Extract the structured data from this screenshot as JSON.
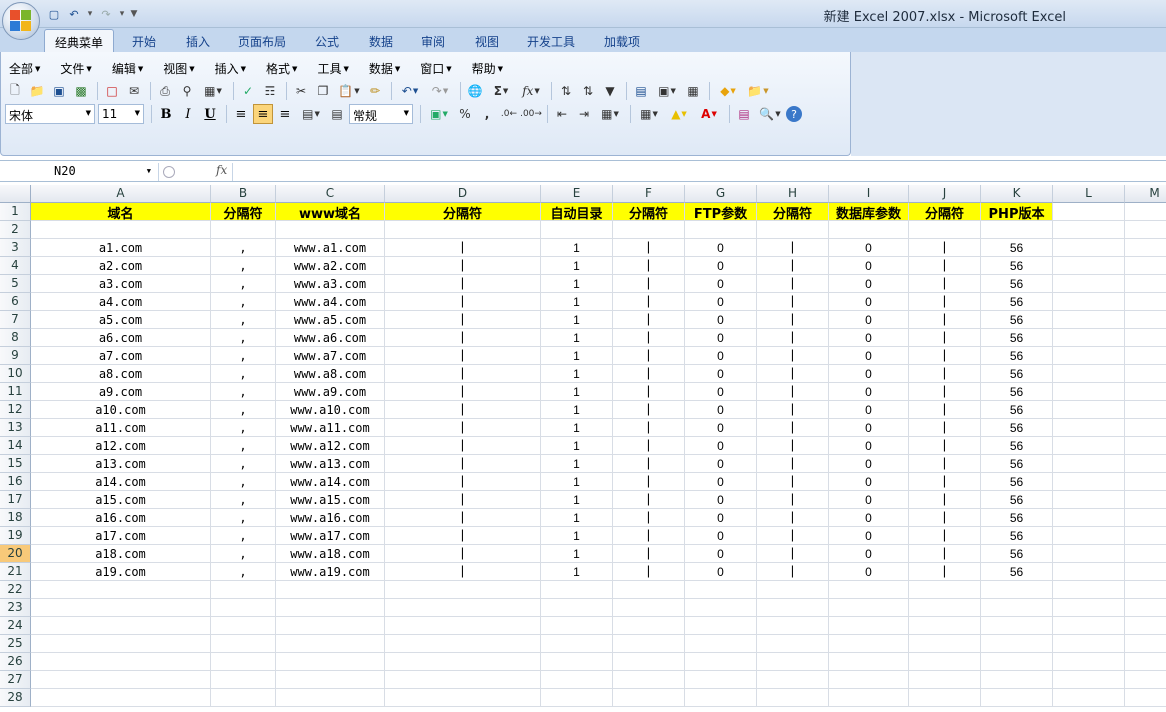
{
  "window": {
    "title": "新建 Excel 2007.xlsx - Microsoft Excel"
  },
  "ribbon_tabs": [
    "经典菜单",
    "开始",
    "插入",
    "页面布局",
    "公式",
    "数据",
    "审阅",
    "视图",
    "开发工具",
    "加载项"
  ],
  "active_tab": "经典菜单",
  "classic_menus": [
    "全部",
    "文件",
    "编辑",
    "视图",
    "插入",
    "格式",
    "工具",
    "数据",
    "窗口",
    "帮助"
  ],
  "toolbar": {
    "font_name": "宋体",
    "font_size": "11",
    "number_format": "常规",
    "bold_label": "B",
    "italic_label": "I",
    "underline_label": "U",
    "sigma_label": "Σ",
    "fx_label": "fx",
    "percent_label": "%",
    "comma_label": ","
  },
  "formula_bar": {
    "name_box": "N20",
    "fx_label": "fx",
    "formula": ""
  },
  "grid": {
    "columns": [
      "A",
      "B",
      "C",
      "D",
      "E",
      "F",
      "G",
      "H",
      "I",
      "J",
      "K",
      "L",
      "M"
    ],
    "row_numbers": [
      "1",
      "2",
      "3",
      "4",
      "5",
      "6",
      "7",
      "8",
      "9",
      "10",
      "11",
      "12",
      "13",
      "14",
      "15",
      "16",
      "17",
      "18",
      "19",
      "20",
      "21",
      "22",
      "23",
      "24",
      "25",
      "26",
      "27",
      "28"
    ],
    "active_row": "20",
    "header_row": [
      "域名",
      "分隔符",
      "www域名",
      "分隔符",
      "自动目录",
      "分隔符",
      "FTP参数",
      "分隔符",
      "数据库参数",
      "分隔符",
      "PHP版本"
    ],
    "data_rows": [
      [
        "a1.com",
        ",",
        "www.a1.com",
        "|",
        "1",
        "|",
        "0",
        "|",
        "0",
        "|",
        "56"
      ],
      [
        "a2.com",
        ",",
        "www.a2.com",
        "|",
        "1",
        "|",
        "0",
        "|",
        "0",
        "|",
        "56"
      ],
      [
        "a3.com",
        ",",
        "www.a3.com",
        "|",
        "1",
        "|",
        "0",
        "|",
        "0",
        "|",
        "56"
      ],
      [
        "a4.com",
        ",",
        "www.a4.com",
        "|",
        "1",
        "|",
        "0",
        "|",
        "0",
        "|",
        "56"
      ],
      [
        "a5.com",
        ",",
        "www.a5.com",
        "|",
        "1",
        "|",
        "0",
        "|",
        "0",
        "|",
        "56"
      ],
      [
        "a6.com",
        ",",
        "www.a6.com",
        "|",
        "1",
        "|",
        "0",
        "|",
        "0",
        "|",
        "56"
      ],
      [
        "a7.com",
        ",",
        "www.a7.com",
        "|",
        "1",
        "|",
        "0",
        "|",
        "0",
        "|",
        "56"
      ],
      [
        "a8.com",
        ",",
        "www.a8.com",
        "|",
        "1",
        "|",
        "0",
        "|",
        "0",
        "|",
        "56"
      ],
      [
        "a9.com",
        ",",
        "www.a9.com",
        "|",
        "1",
        "|",
        "0",
        "|",
        "0",
        "|",
        "56"
      ],
      [
        "a10.com",
        ",",
        "www.a10.com",
        "|",
        "1",
        "|",
        "0",
        "|",
        "0",
        "|",
        "56"
      ],
      [
        "a11.com",
        ",",
        "www.a11.com",
        "|",
        "1",
        "|",
        "0",
        "|",
        "0",
        "|",
        "56"
      ],
      [
        "a12.com",
        ",",
        "www.a12.com",
        "|",
        "1",
        "|",
        "0",
        "|",
        "0",
        "|",
        "56"
      ],
      [
        "a13.com",
        ",",
        "www.a13.com",
        "|",
        "1",
        "|",
        "0",
        "|",
        "0",
        "|",
        "56"
      ],
      [
        "a14.com",
        ",",
        "www.a14.com",
        "|",
        "1",
        "|",
        "0",
        "|",
        "0",
        "|",
        "56"
      ],
      [
        "a15.com",
        ",",
        "www.a15.com",
        "|",
        "1",
        "|",
        "0",
        "|",
        "0",
        "|",
        "56"
      ],
      [
        "a16.com",
        ",",
        "www.a16.com",
        "|",
        "1",
        "|",
        "0",
        "|",
        "0",
        "|",
        "56"
      ],
      [
        "a17.com",
        ",",
        "www.a17.com",
        "|",
        "1",
        "|",
        "0",
        "|",
        "0",
        "|",
        "56"
      ],
      [
        "a18.com",
        ",",
        "www.a18.com",
        "|",
        "1",
        "|",
        "0",
        "|",
        "0",
        "|",
        "56"
      ],
      [
        "a19.com",
        ",",
        "www.a19.com",
        "|",
        "1",
        "|",
        "0",
        "|",
        "0",
        "|",
        "56"
      ]
    ]
  },
  "colors": {
    "header_fill": "#ffff00",
    "active_row_header": "#f8c979",
    "ribbon_blue": "#c4d7ee"
  }
}
